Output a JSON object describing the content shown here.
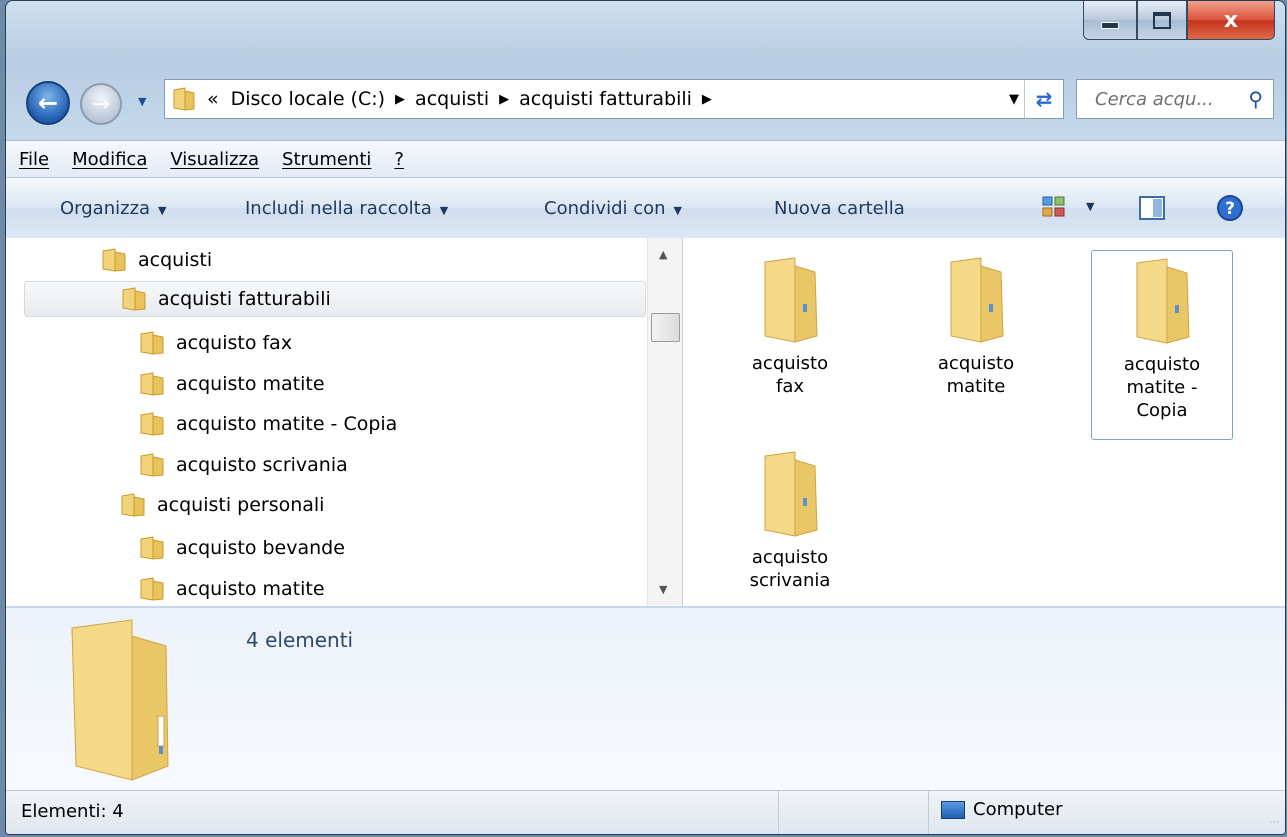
{
  "window": {
    "caption": {
      "minimize": "minimize",
      "maximize": "maximize",
      "close": "x"
    }
  },
  "address": {
    "overflow": "«",
    "crumbs": [
      "Disco locale (C:)",
      "acquisti",
      "acquisti fatturabili"
    ],
    "search_placeholder": "Cerca acqu..."
  },
  "menu": [
    "File",
    "Modifica",
    "Visualizza",
    "Strumenti",
    "?"
  ],
  "toolbar": {
    "organize": "Organizza",
    "include": "Includi nella raccolta",
    "share": "Condividi con",
    "new_folder": "Nuova cartella"
  },
  "tree": [
    {
      "label": "acquisti",
      "level": 0,
      "selected": false
    },
    {
      "label": "acquisti fatturabili",
      "level": 1,
      "selected": true
    },
    {
      "label": "acquisto fax",
      "level": 2,
      "selected": false
    },
    {
      "label": "acquisto matite",
      "level": 2,
      "selected": false
    },
    {
      "label": "acquisto matite - Copia",
      "level": 2,
      "selected": false
    },
    {
      "label": "acquisto scrivania",
      "level": 2,
      "selected": false
    },
    {
      "label": "acquisti personali",
      "level": 1,
      "selected": false
    },
    {
      "label": "acquisto bevande",
      "level": 2,
      "selected": false
    },
    {
      "label": "acquisto matite",
      "level": 2,
      "selected": false
    }
  ],
  "files": [
    {
      "line1": "acquisto",
      "line2": "fax",
      "line3": ""
    },
    {
      "line1": "acquisto",
      "line2": "matite",
      "line3": ""
    },
    {
      "line1": "acquisto",
      "line2": "matite -",
      "line3": "Copia"
    },
    {
      "line1": "acquisto",
      "line2": "scrivania",
      "line3": ""
    }
  ],
  "details": {
    "count": "4 elementi"
  },
  "status": {
    "items": "Elementi: 4",
    "location": "Computer"
  }
}
